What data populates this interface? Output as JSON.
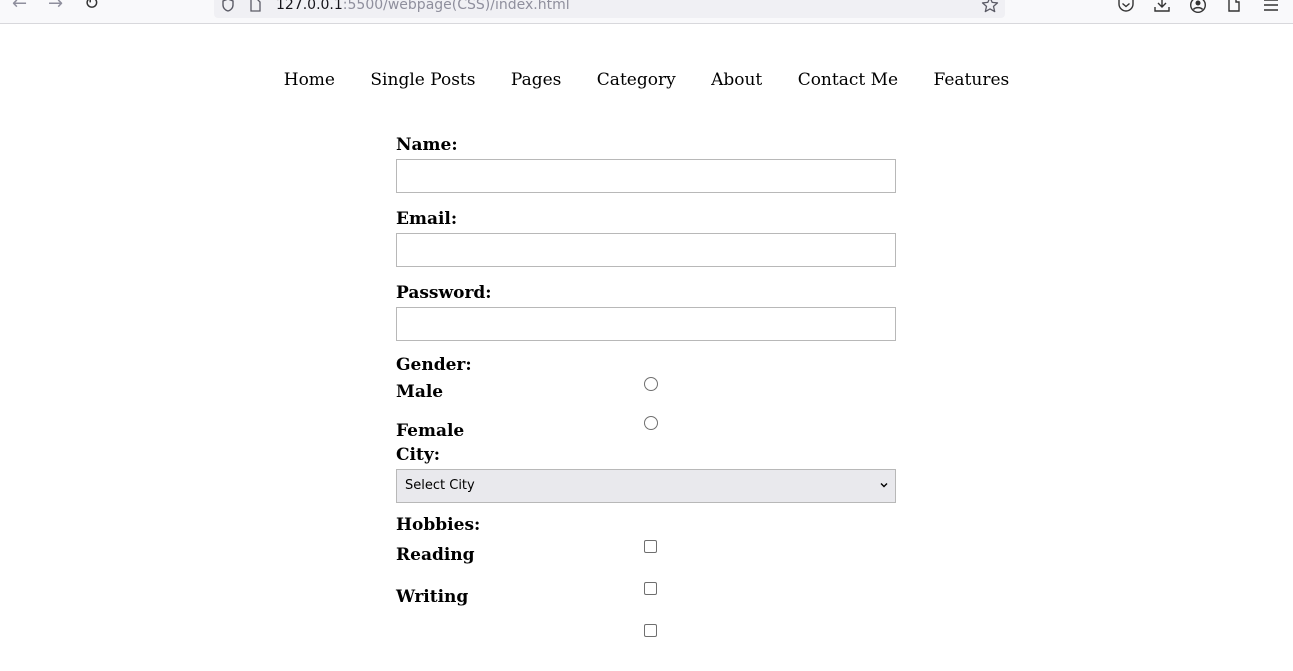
{
  "browser": {
    "url_host": "127.0.0.1",
    "url_path": ":5500/webpage(CSS)/index.html"
  },
  "nav": {
    "items": [
      "Home",
      "Single Posts",
      "Pages",
      "Category",
      "About",
      "Contact Me",
      "Features"
    ]
  },
  "form": {
    "name_label": "Name:",
    "name_value": "",
    "email_label": "Email:",
    "email_value": "",
    "password_label": "Password:",
    "password_value": "",
    "gender_label": "Gender:",
    "gender_options": [
      "Male",
      "Female"
    ],
    "city_label": "City:",
    "city_selected": "Select City",
    "hobbies_label": "Hobbies:",
    "hobby_options": [
      "Reading",
      "Writing"
    ]
  },
  "icons": {
    "back": "arrow-left-icon",
    "forward": "arrow-right-icon",
    "reload": "reload-icon",
    "bookmark": "star-icon",
    "pocket": "pocket-icon",
    "downloads": "download-icon",
    "account": "account-icon",
    "extensions": "extensions-icon",
    "menu": "hamburger-menu-icon"
  }
}
